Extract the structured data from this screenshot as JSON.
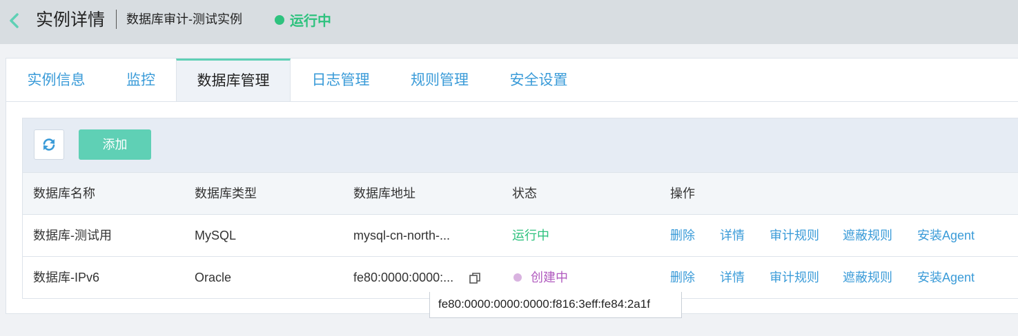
{
  "header": {
    "title": "实例详情",
    "instance_name": "数据库审计-测试实例",
    "status": "运行中",
    "status_color": "#2ec27e"
  },
  "tabs": [
    {
      "label": "实例信息",
      "active": false
    },
    {
      "label": "监控",
      "active": false
    },
    {
      "label": "数据库管理",
      "active": true
    },
    {
      "label": "日志管理",
      "active": false
    },
    {
      "label": "规则管理",
      "active": false
    },
    {
      "label": "安全设置",
      "active": false
    }
  ],
  "toolbar": {
    "refresh_icon": "refresh-icon",
    "add_label": "添加",
    "accent_color": "#5fd0b5"
  },
  "table": {
    "columns": [
      "数据库名称",
      "数据库类型",
      "数据库地址",
      "状态",
      "操作"
    ],
    "rows": [
      {
        "name": "数据库-测试用",
        "type": "MySQL",
        "address": "mysql-cn-north-...",
        "status": "运行中",
        "actions": [
          "删除",
          "详情",
          "审计规则",
          "遮蔽规则",
          "安装Agent"
        ]
      },
      {
        "name": "数据库-IPv6",
        "type": "Oracle",
        "address": "fe80:0000:0000:...",
        "status": "创建中",
        "actions": [
          "删除",
          "详情",
          "审计规则",
          "遮蔽规则",
          "安装Agent"
        ]
      }
    ]
  },
  "tooltip": {
    "text": "fe80:0000:0000:0000:f816:3eff:fe84:2a1f"
  }
}
